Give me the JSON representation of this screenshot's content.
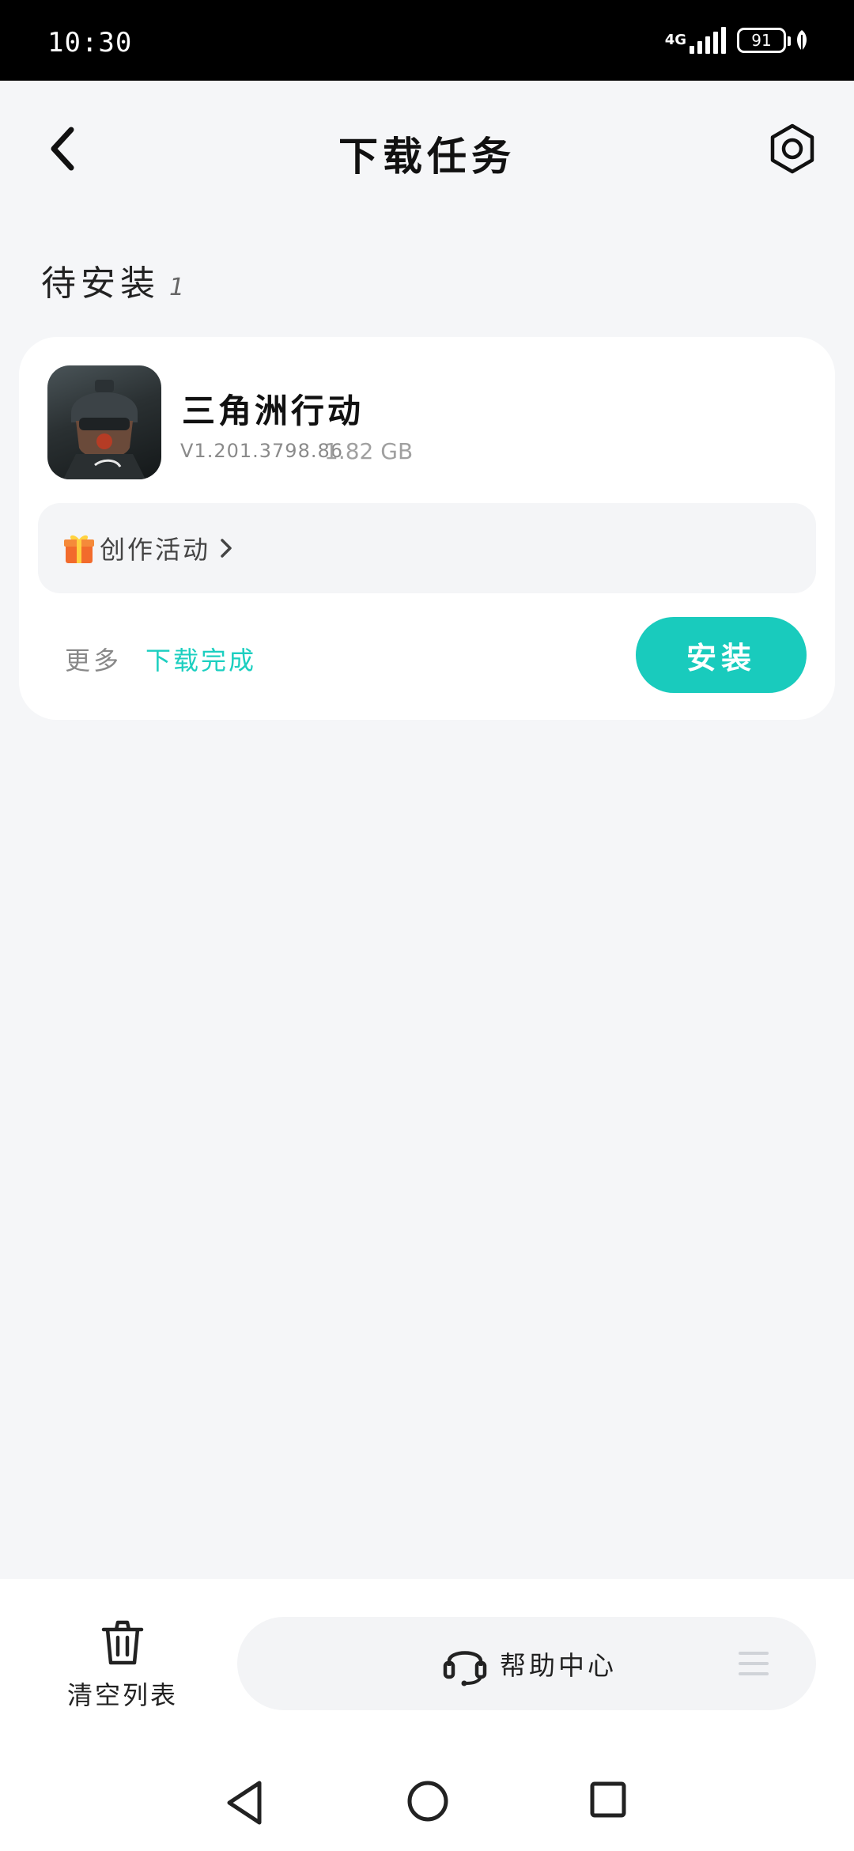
{
  "status_bar": {
    "time": "10:30",
    "network": "4G",
    "battery": "91"
  },
  "header": {
    "title": "下载任务"
  },
  "section": {
    "title": "待安装",
    "count": "1"
  },
  "task": {
    "app_name": "三角洲行动",
    "version": "V1.201.3798.86",
    "size": "1.82 GB",
    "promo_label": "创作活动",
    "more_label": "更多",
    "status": "下载完成",
    "install_label": "安装"
  },
  "bottom": {
    "clear_label": "清空列表",
    "help_label": "帮助中心"
  },
  "colors": {
    "accent": "#19cbbd",
    "background": "#f5f6f8",
    "card": "#ffffff"
  }
}
